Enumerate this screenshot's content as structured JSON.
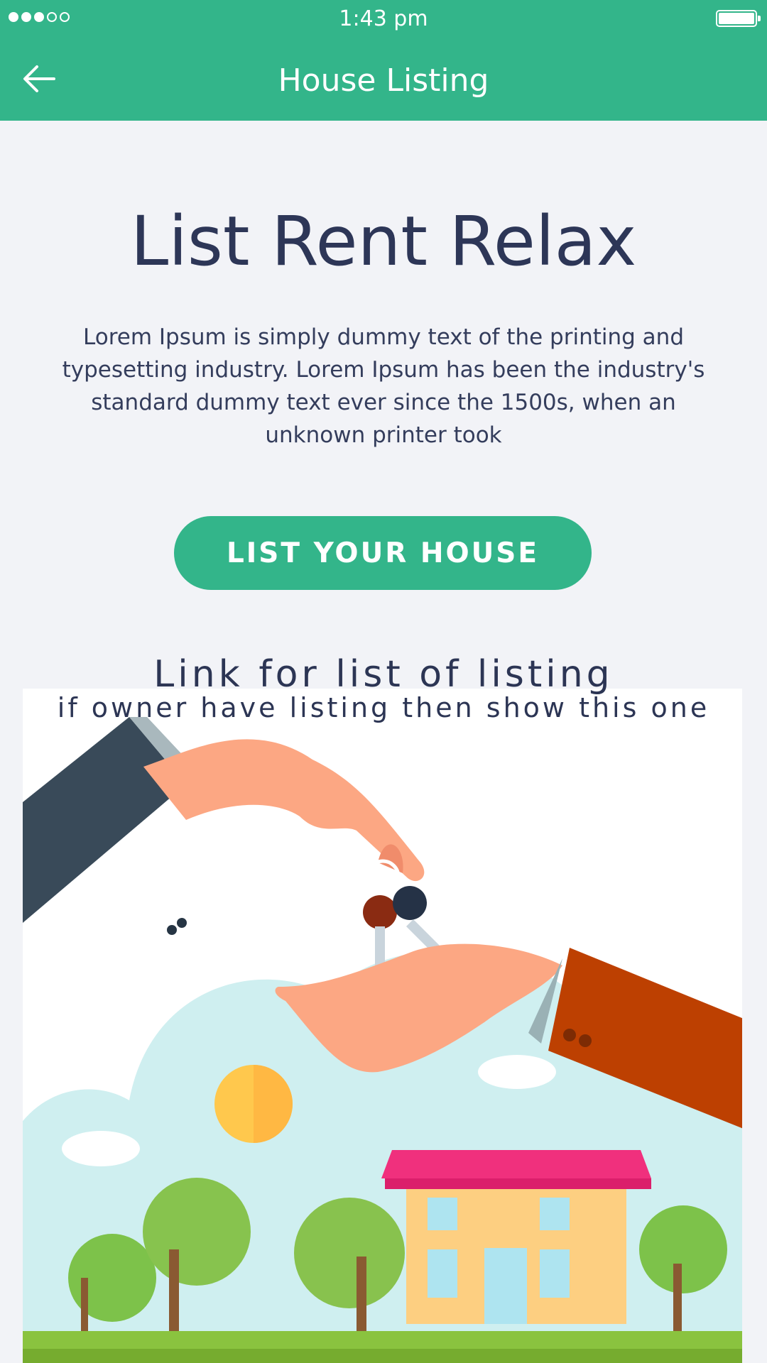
{
  "status_bar": {
    "time": "1:43 pm"
  },
  "app_bar": {
    "title": "House Listing",
    "back_icon": "arrow-left-icon"
  },
  "hero": {
    "title": "List Rent Relax",
    "description": "Lorem Ipsum is simply dummy text of the printing and typesetting industry. Lorem Ipsum has been the industry's standard dummy text ever since the 1500s, when an unknown printer took",
    "button_label": "LIST YOUR HOUSE"
  },
  "listing": {
    "link_label": "Link for list of listing",
    "note": "if owner have listing then show this one"
  },
  "theme": {
    "accent": "#33b58a",
    "text": "#2d3657",
    "background": "#f2f3f7"
  }
}
